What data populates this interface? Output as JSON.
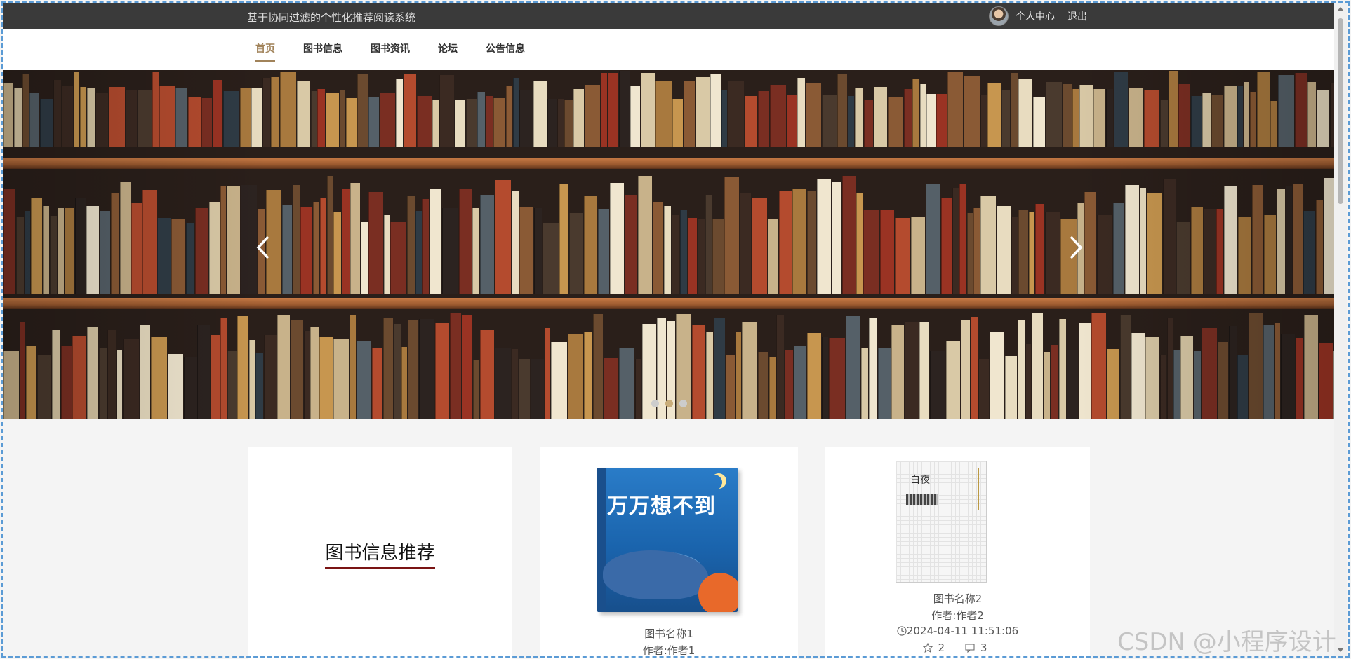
{
  "header": {
    "site_title": "基于协同过滤的个性化推荐阅读系统",
    "user_center": "个人中心",
    "logout": "退出"
  },
  "nav": {
    "items": [
      {
        "label": "首页",
        "active": true
      },
      {
        "label": "图书信息",
        "active": false
      },
      {
        "label": "图书资讯",
        "active": false
      },
      {
        "label": "论坛",
        "active": false
      },
      {
        "label": "公告信息",
        "active": false
      }
    ]
  },
  "banner": {
    "slide_count": 3,
    "active_slide": 2
  },
  "recommend": {
    "title": "图书信息推荐"
  },
  "books": [
    {
      "name": "图书名称1",
      "author": "作者:作者1",
      "cover_title": "万万想不到"
    },
    {
      "name": "图书名称2",
      "author": "作者:作者2",
      "time": "2024-04-11 11:51:06",
      "likes": "2",
      "comments": "3",
      "cover_title": "白夜"
    }
  ],
  "watermark": "CSDN @小程序设计",
  "colors": {
    "accent": "#a1835a",
    "topbar": "#3a3a3a",
    "underline": "#7a1414"
  }
}
